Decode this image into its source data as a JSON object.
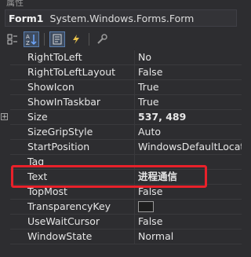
{
  "panel": {
    "title": "属性"
  },
  "selector": {
    "object_name": "Form1",
    "object_type": "System.Windows.Forms.Form"
  },
  "properties": [
    {
      "name": "RightToLeft",
      "value": "No"
    },
    {
      "name": "RightToLeftLayout",
      "value": "False"
    },
    {
      "name": "ShowIcon",
      "value": "True"
    },
    {
      "name": "ShowInTaskbar",
      "value": "True"
    },
    {
      "name": "Size",
      "value": "537, 489"
    },
    {
      "name": "SizeGripStyle",
      "value": "Auto"
    },
    {
      "name": "StartPosition",
      "value": "WindowsDefaultLocation"
    },
    {
      "name": "Tag",
      "value": ""
    },
    {
      "name": "Text",
      "value": "进程通信"
    },
    {
      "name": "TopMost",
      "value": "False"
    },
    {
      "name": "TransparencyKey",
      "value": ""
    },
    {
      "name": "UseWaitCursor",
      "value": "False"
    },
    {
      "name": "WindowState",
      "value": "Normal"
    }
  ],
  "colors": {
    "highlight_border": "#e8212a",
    "background": "#2d2d30",
    "grid_line": "#3a3a3d"
  }
}
